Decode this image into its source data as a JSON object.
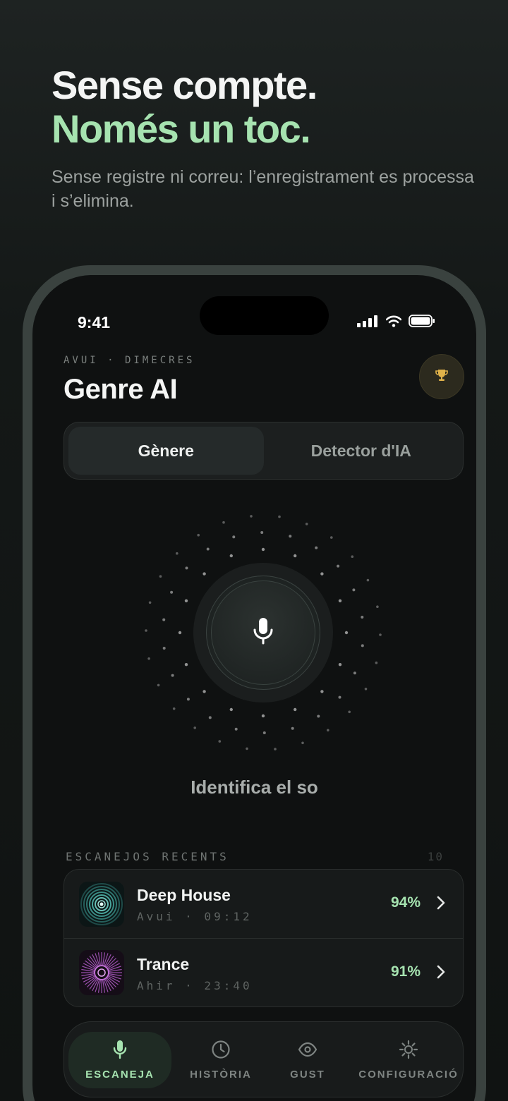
{
  "promo": {
    "line1": "Sense compte.",
    "line2": "Només un toc.",
    "subtitle": "Sense registre ni correu: l’enregistrament es processa i s’elimina."
  },
  "status_bar": {
    "time": "9:41"
  },
  "header": {
    "date_label": "AVUI · DIMECRES",
    "title": "Genre AI",
    "trophy_icon": "trophy-icon"
  },
  "segments": [
    {
      "label": "Gènere",
      "active": true
    },
    {
      "label": "Detector d'IA",
      "active": false
    }
  ],
  "scanner": {
    "label": "Identifica el so",
    "icon": "microphone-icon"
  },
  "recent": {
    "label": "ESCANEJOS RECENTS",
    "count": "10",
    "items": [
      {
        "title": "Deep House",
        "meta": "Avui · 09:12",
        "percent": "94%"
      },
      {
        "title": "Trance",
        "meta": "Ahir · 23:40",
        "percent": "91%"
      }
    ]
  },
  "tabs": [
    {
      "label": "ESCANEJA",
      "icon": "microphone-icon",
      "active": true
    },
    {
      "label": "HISTÒRIA",
      "icon": "clock-icon",
      "active": false
    },
    {
      "label": "GUST",
      "icon": "eye-icon",
      "active": false
    },
    {
      "label": "CONFIGURACIÓ",
      "icon": "gear-icon",
      "active": false
    }
  ],
  "colors": {
    "accent": "#a6e3b0",
    "background": "#0f1111",
    "trophy": "#e0b24a"
  }
}
